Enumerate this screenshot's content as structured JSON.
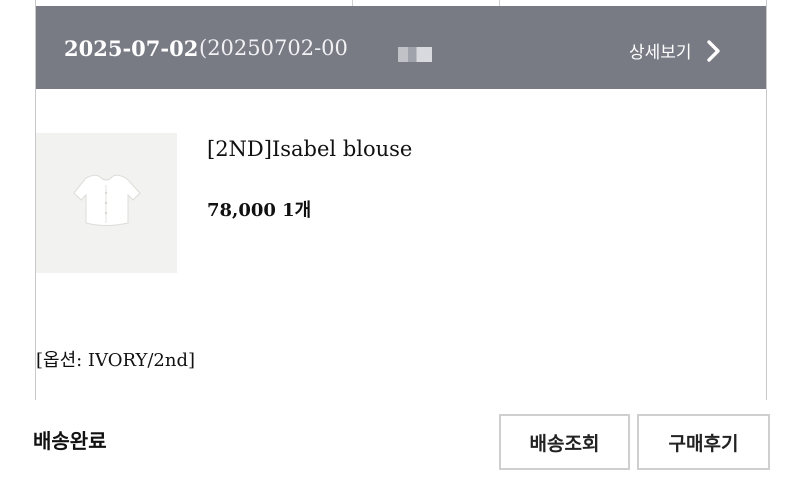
{
  "order": {
    "date": "2025-07-02",
    "number_partial": "(20250702-00",
    "detail_label": "상세보기"
  },
  "product": {
    "name": "[2ND]Isabel blouse",
    "price_qty": "78,000 1개",
    "option": "[옵션: IVORY/2nd]"
  },
  "delivery": {
    "status": "배송완료",
    "track_label": "배송조회",
    "review_label": "구매후기"
  },
  "icons": {
    "detail": "chevron-right-icon"
  },
  "colors": {
    "header_bg": "#787a84",
    "button_border": "#cfcfcf"
  }
}
